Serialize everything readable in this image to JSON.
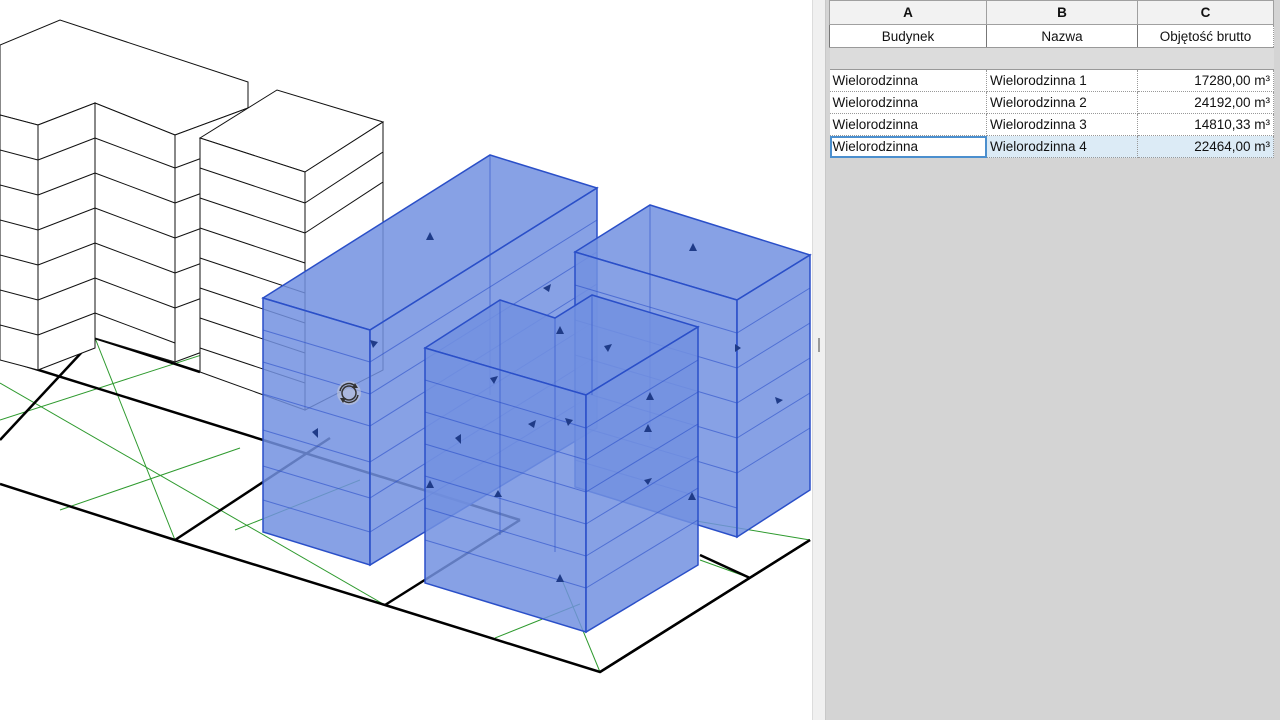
{
  "schedule": {
    "column_letters": [
      "A",
      "B",
      "C"
    ],
    "headers": [
      "Budynek",
      "Nazwa",
      "Objętość brutto"
    ],
    "rows": [
      {
        "budynek": "Wielorodzinna",
        "nazwa": "Wielorodzinna 1",
        "objetosc": "17280,00 m³"
      },
      {
        "budynek": "Wielorodzinna",
        "nazwa": "Wielorodzinna 2",
        "objetosc": "24192,00 m³"
      },
      {
        "budynek": "Wielorodzinna",
        "nazwa": "Wielorodzinna 3",
        "objetosc": "14810,33 m³"
      },
      {
        "budynek": "Wielorodzinna",
        "nazwa": "Wielorodzinna 4",
        "objetosc": "22464,00 m³"
      }
    ],
    "selected_row": 3
  },
  "viewport": {
    "selected_mass_fill": "#7290e0",
    "selected_mass_edge": "#2a4fc8",
    "ground_grid_color": "#2e9a2e",
    "cursor_icon": "orbit-icon"
  }
}
